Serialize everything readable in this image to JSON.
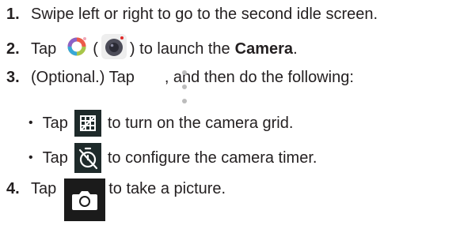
{
  "steps": [
    {
      "num": "1.",
      "text": "Swipe left or right to go to the second idle screen."
    },
    {
      "num": "2.",
      "pre": "Tap",
      "mid1": "(",
      "mid2": ") to launch the",
      "bold": "Camera",
      "post": "."
    },
    {
      "num": "3.",
      "pre": "(Optional.) Tap",
      "post": ", and then do the following:"
    },
    {
      "num": "4.",
      "pre": "Tap",
      "post": "to take a picture."
    }
  ],
  "bullets": [
    {
      "marker": "•",
      "pre": "Tap",
      "post": "to turn on the camera grid."
    },
    {
      "marker": "•",
      "pre": "Tap",
      "post": "to configure the camera timer."
    }
  ],
  "icons": {
    "camera_app_ring": "camera-app-ring-icon",
    "camera_app_lens": "camera-app-lens-icon",
    "more_options": "more-options-icon",
    "grid": "grid-icon",
    "timer": "timer-icon",
    "shutter": "shutter-icon"
  }
}
